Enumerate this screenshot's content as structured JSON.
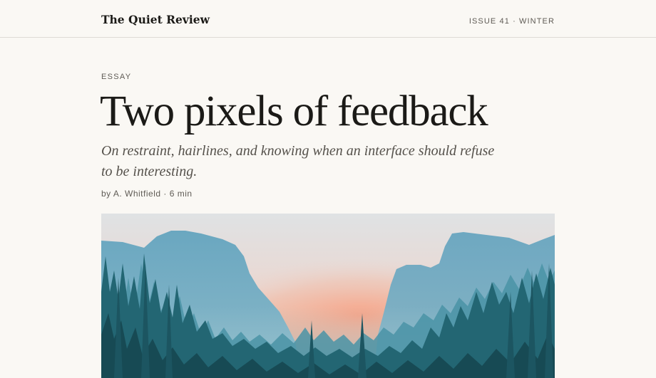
{
  "masthead": {
    "brand": "The Quiet Review",
    "issue": "ISSUE 41 · WINTER"
  },
  "article": {
    "kicker": "ESSAY",
    "title": "Two pixels of feedback",
    "dek": "On restraint, hairlines, and knowing when an interface should refuse to be interesting.",
    "byline": "by A. Whitfield · 6 min"
  },
  "hero_image": {
    "subject": "misty valley with mountains and pine forest at sunrise",
    "palette": {
      "sky_top": "#d9dde0",
      "glow": "#f4a98b",
      "mountain": "#6aa5bd",
      "forest_far": "#3f8ba0",
      "forest_near": "#1f5a66"
    }
  },
  "colors": {
    "background": "#faf8f4",
    "text": "#1b1a17",
    "muted": "#5f5b55",
    "rule": "#dedbd5"
  }
}
